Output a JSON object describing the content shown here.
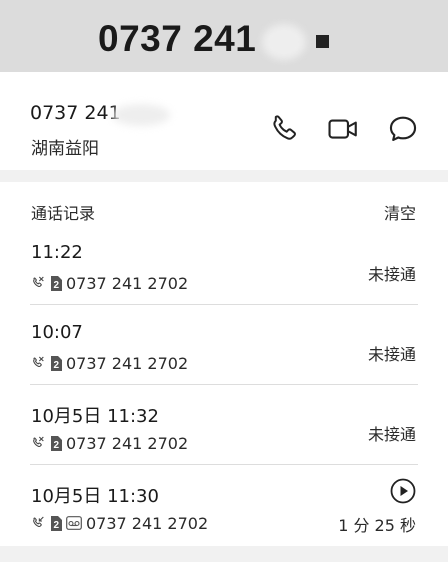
{
  "header": {
    "title": "0737 241",
    "stop_icon": "stop-icon"
  },
  "contact": {
    "number": "0737 241",
    "location": "湖南益阳",
    "actions": [
      "phone-icon",
      "video-call-icon",
      "message-icon"
    ]
  },
  "call_log": {
    "title": "通话记录",
    "clear_label": "清空",
    "entries": [
      {
        "time": "11:22",
        "sim": "2",
        "number": "0737 241 2702",
        "status": "未接通",
        "icons": [
          "missed-call-icon",
          "sim-2-icon"
        ]
      },
      {
        "time": "10:07",
        "sim": "2",
        "number": "0737 241 2702",
        "status": "未接通",
        "icons": [
          "missed-call-icon",
          "sim-2-icon"
        ]
      },
      {
        "time": "10月5日 11:32",
        "sim": "2",
        "number": "0737 241 2702",
        "status": "未接通",
        "icons": [
          "missed-call-icon",
          "sim-2-icon"
        ]
      },
      {
        "time": "10月5日 11:30",
        "sim": "2",
        "number": "0737 241 2702",
        "duration": "1 分 25 秒",
        "icons": [
          "incoming-call-icon",
          "sim-2-icon",
          "voicemail-icon",
          "play-icon"
        ]
      }
    ]
  },
  "colors": {
    "header_bg": "#dcdcdc",
    "card_bg": "#ffffff",
    "page_bg": "#f1f1f1",
    "text": "#1f1f1f",
    "divider": "#dddddd"
  }
}
